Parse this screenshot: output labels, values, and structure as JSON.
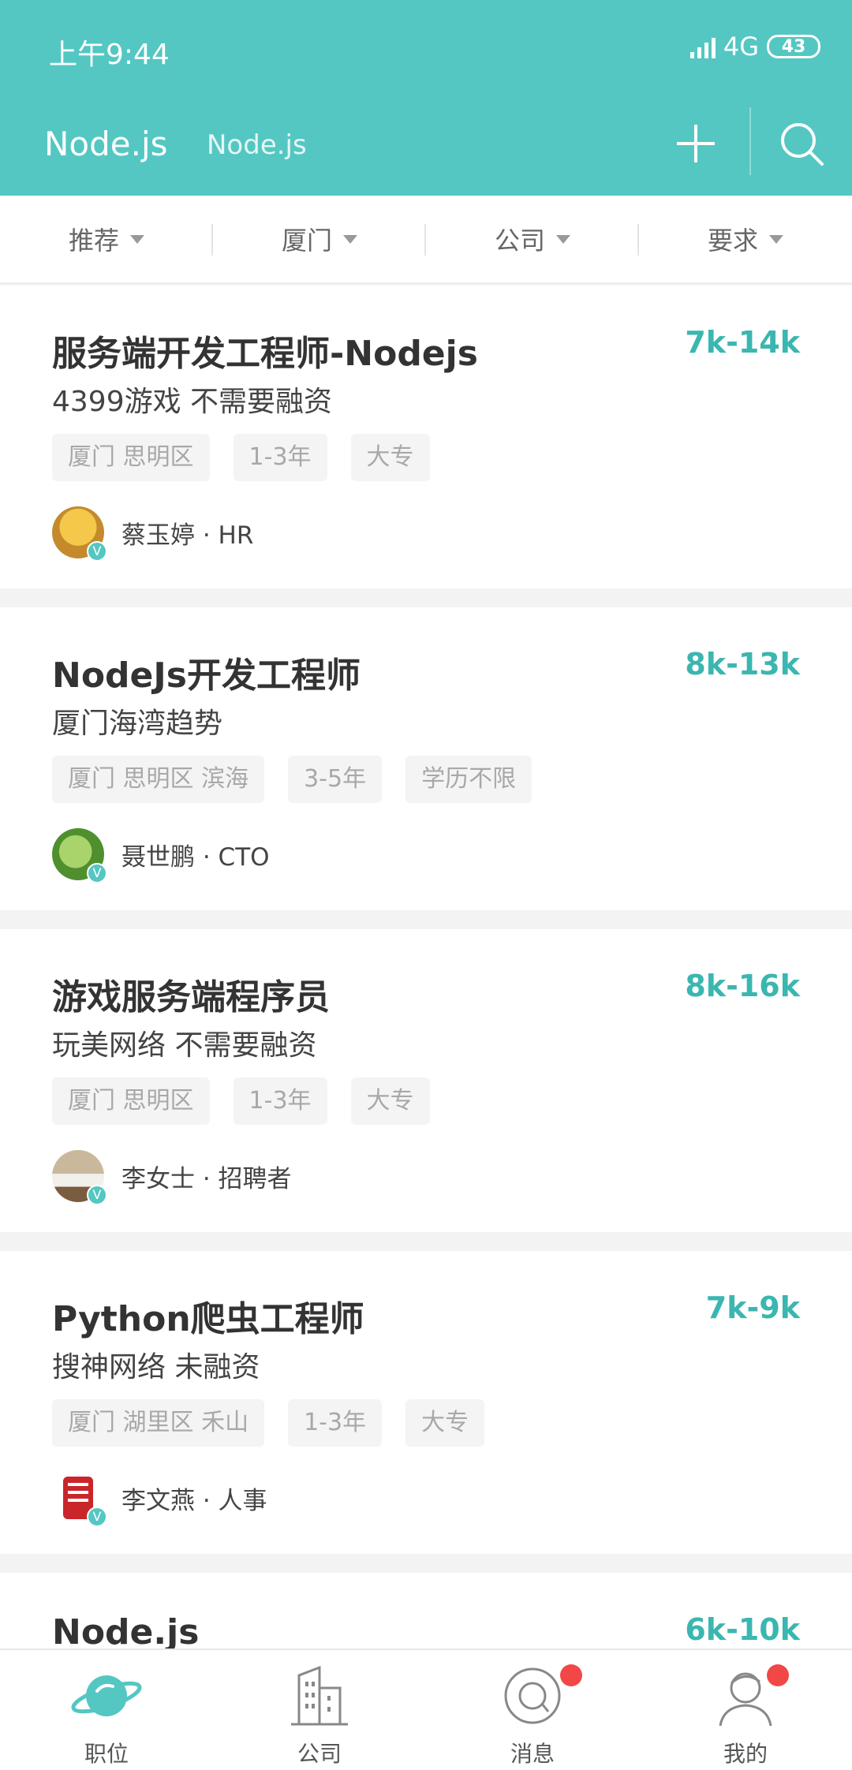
{
  "status": {
    "time": "上午9:44",
    "network": "4G",
    "battery": "43"
  },
  "header": {
    "title": "Node.js",
    "subtitle": "Node.js"
  },
  "filters": [
    "推荐",
    "厦门",
    "公司",
    "要求"
  ],
  "jobs": [
    {
      "title": "服务端开发工程师-Nodejs",
      "salary": "7k-14k",
      "company": "4399游戏  不需要融资",
      "tags": [
        "厦门 思明区",
        "1-3年",
        "大专"
      ],
      "recruiter": "蔡玉婷 · HR",
      "avatar_color": "#e9a93d"
    },
    {
      "title": "NodeJs开发工程师",
      "salary": "8k-13k",
      "company": "厦门海湾趋势",
      "tags": [
        "厦门 思明区 滨海",
        "3-5年",
        "学历不限"
      ],
      "recruiter": "聂世鹏 · CTO",
      "avatar_color": "#6ba84a"
    },
    {
      "title": "游戏服务端程序员",
      "salary": "8k-16k",
      "company": "玩美网络  不需要融资",
      "tags": [
        "厦门 思明区",
        "1-3年",
        "大专"
      ],
      "recruiter": "李女士 · 招聘者",
      "avatar_color": "#8b6b4e"
    },
    {
      "title": "Python爬虫工程师",
      "salary": "7k-9k",
      "company": "搜神网络  未融资",
      "tags": [
        "厦门 湖里区 禾山",
        "1-3年",
        "大专"
      ],
      "recruiter": "李文燕 · 人事",
      "avatar_color": "#c9252b"
    },
    {
      "title": "Node.js",
      "salary": "6k-10k"
    }
  ],
  "verify_mark": "V",
  "nav": [
    {
      "label": "职位",
      "icon": "planet-icon",
      "active": true
    },
    {
      "label": "公司",
      "icon": "building-icon"
    },
    {
      "label": "消息",
      "icon": "chat-icon",
      "badge": true
    },
    {
      "label": "我的",
      "icon": "user-icon",
      "badge": true
    }
  ],
  "colors": {
    "primary": "#54c7c2",
    "salary": "#3bb6b0",
    "badge": "#f24747"
  }
}
